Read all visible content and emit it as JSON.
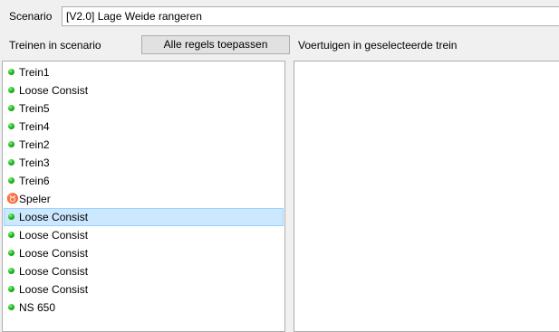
{
  "scenario": {
    "label": "Scenario",
    "value": "[V2.0] Lage Weide rangeren"
  },
  "trains_label": "Treinen in scenario",
  "apply_button": "Alle regels toepassen",
  "vehicles_label": "Voertuigen in geselecteerde trein",
  "train_list": [
    {
      "label": "Trein1",
      "icon": "green-dot-icon"
    },
    {
      "label": "Loose Consist",
      "icon": "green-dot-icon"
    },
    {
      "label": "Trein5",
      "icon": "green-dot-icon"
    },
    {
      "label": "Trein4",
      "icon": "green-dot-icon"
    },
    {
      "label": "Trein2",
      "icon": "green-dot-icon"
    },
    {
      "label": "Trein3",
      "icon": "green-dot-icon"
    },
    {
      "label": "Trein6",
      "icon": "green-dot-icon"
    },
    {
      "label": "Speler",
      "icon": "player-icon",
      "glyph": "♉"
    },
    {
      "label": "Loose Consist",
      "icon": "green-dot-icon",
      "selected": true
    },
    {
      "label": "Loose Consist",
      "icon": "green-dot-icon"
    },
    {
      "label": "Loose Consist",
      "icon": "green-dot-icon"
    },
    {
      "label": "Loose Consist",
      "icon": "green-dot-icon"
    },
    {
      "label": "Loose Consist",
      "icon": "green-dot-icon"
    },
    {
      "label": "NS 650",
      "icon": "green-dot-icon"
    }
  ],
  "vehicle_list": [],
  "colors": {
    "selection_background": "#cce8ff",
    "selection_border": "#99d1ff",
    "status_green": "#1fbf1f"
  }
}
